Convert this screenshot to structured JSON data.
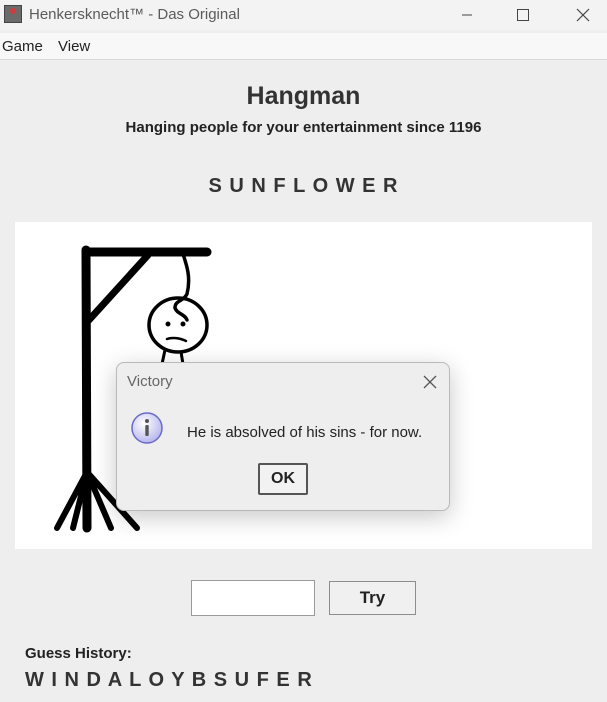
{
  "window": {
    "title": "Henkersknecht™ - Das Original",
    "icon": "app-icon",
    "controls": [
      "minimize-icon",
      "maximize-icon",
      "close-icon"
    ]
  },
  "menu": {
    "items": [
      {
        "label": "Game"
      },
      {
        "label": "View"
      }
    ]
  },
  "header": {
    "title": "Hangman",
    "subtitle": "Hanging people for your entertainment since 1196"
  },
  "word": "S U N F L O W E R",
  "guess": {
    "input_value": "",
    "button_label": "Try"
  },
  "history": {
    "label": "Guess History:",
    "letters": "W I N D A L O Y B S U F E R"
  },
  "dialog": {
    "title": "Victory",
    "message": "He is absolved of his sins - for now.",
    "ok_label": "OK",
    "icon": "info-icon"
  }
}
